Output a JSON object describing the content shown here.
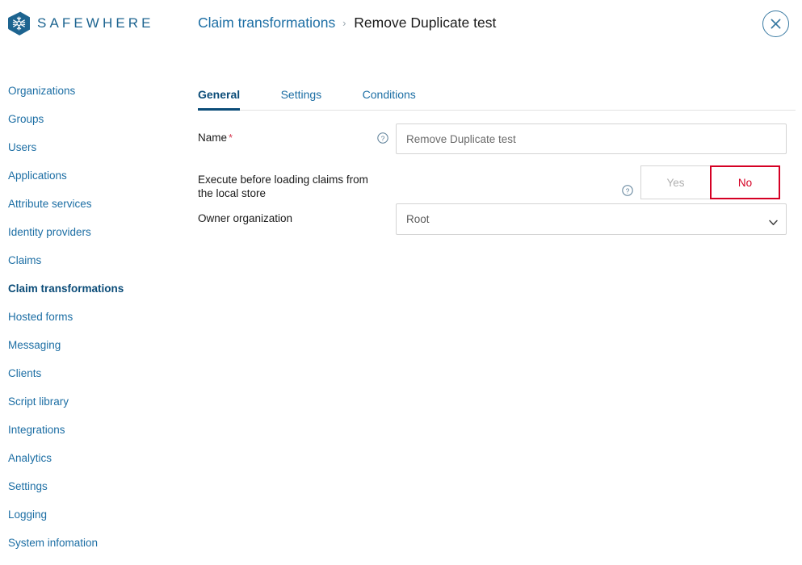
{
  "brand": {
    "name": "SAFEWHERE",
    "logo_icon": "snowflake-hex-logo",
    "logo_color": "#1d6490"
  },
  "header": {
    "breadcrumb_parent": "Claim transformations",
    "breadcrumb_separator": "›",
    "breadcrumb_current": "Remove Duplicate test",
    "close_icon": "close-x-icon"
  },
  "sidebar": {
    "items": [
      {
        "label": "Organizations",
        "active": false
      },
      {
        "label": "Groups",
        "active": false
      },
      {
        "label": "Users",
        "active": false
      },
      {
        "label": "Applications",
        "active": false
      },
      {
        "label": "Attribute services",
        "active": false
      },
      {
        "label": "Identity providers",
        "active": false
      },
      {
        "label": "Claims",
        "active": false
      },
      {
        "label": "Claim transformations",
        "active": true
      },
      {
        "label": "Hosted forms",
        "active": false
      },
      {
        "label": "Messaging",
        "active": false
      },
      {
        "label": "Clients",
        "active": false
      },
      {
        "label": "Script library",
        "active": false
      },
      {
        "label": "Integrations",
        "active": false
      },
      {
        "label": "Analytics",
        "active": false
      },
      {
        "label": "Settings",
        "active": false
      },
      {
        "label": "Logging",
        "active": false
      },
      {
        "label": "System infomation",
        "active": false
      }
    ]
  },
  "main": {
    "tabs": [
      {
        "label": "General",
        "active": true
      },
      {
        "label": "Settings",
        "active": false
      },
      {
        "label": "Conditions",
        "active": false
      }
    ],
    "fields": {
      "name": {
        "label": "Name",
        "required_marker": "*",
        "help_icon": "question-circle-icon",
        "value": "Remove Duplicate test",
        "placeholder": ""
      },
      "execute_before": {
        "label": "Execute before loading claims from the local store",
        "help_icon": "question-circle-icon",
        "yes_label": "Yes",
        "no_label": "No",
        "selected": "No"
      },
      "owner_organization": {
        "label": "Owner organization",
        "value": "Root",
        "chevron_icon": "chevron-down-icon",
        "options": [
          "Root"
        ]
      }
    }
  },
  "colors": {
    "link": "#1c6ea4",
    "active_nav": "#0b4c78",
    "required_asterisk": "#d63a52",
    "danger": "#d50024",
    "border": "#d4d4d4"
  }
}
